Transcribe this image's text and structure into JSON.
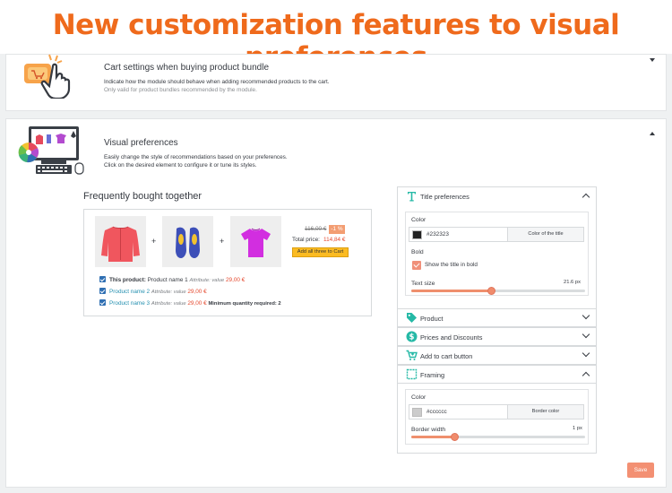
{
  "banner": {
    "title": "New customization features to visual preferences"
  },
  "cart_settings": {
    "title": "Cart settings when buying product bundle",
    "desc": "Indicate how the module should behave when adding recommended products to the cart.",
    "note": "Only valid for product bundles recommended by the module."
  },
  "visual_prefs": {
    "title": "Visual preferences",
    "desc": "Easily change the style of recommendations based on your preferences.",
    "note": "Click on the desired element to configure it or tune its styles."
  },
  "preview": {
    "title": "Frequently bought together",
    "old_price": "116,00 €",
    "discount": "-1 %",
    "total_label": "Total price:",
    "total_price": "114,84 €",
    "add_button": "Add all three to Cart",
    "items": [
      {
        "prefix": "This product:",
        "name": "Product name 1",
        "attr": "Attribute: value",
        "price": "29,00 €",
        "extra": ""
      },
      {
        "prefix": "",
        "name": "Product name 2",
        "attr": "Attribute: value",
        "price": "29,00 €",
        "extra": ""
      },
      {
        "prefix": "",
        "name": "Product name 3",
        "attr": "Attribute: value",
        "price": "29,00 €",
        "extra": "Minimum quantity required: 2"
      }
    ]
  },
  "panel": {
    "title_prefs": {
      "label": "Title preferences",
      "color_label": "Color",
      "color_value": "#232323",
      "color_button": "Color of the title",
      "bold_label": "Bold",
      "bold_checkbox": "Show the title in bold",
      "bold_checked": true,
      "text_size_label": "Text size",
      "text_size_value": "21.6 px",
      "text_size_fraction": 0.46
    },
    "product": {
      "label": "Product"
    },
    "prices": {
      "label": "Prices and Discounts"
    },
    "add_to_cart": {
      "label": "Add to cart button"
    },
    "framing": {
      "label": "Framing",
      "color_label": "Color",
      "color_value": "#cccccc",
      "color_button": "Border color",
      "border_label": "Border width",
      "border_value": "1 px",
      "border_fraction": 0.25
    }
  },
  "save_button": "Save",
  "colors": {
    "accent": "#ef6a1c",
    "title_swatch": "#232323",
    "border_swatch": "#cccccc",
    "link": "#2590b0",
    "price": "#e5492e",
    "add_button": "#fbbb22",
    "save": "#f39073"
  }
}
